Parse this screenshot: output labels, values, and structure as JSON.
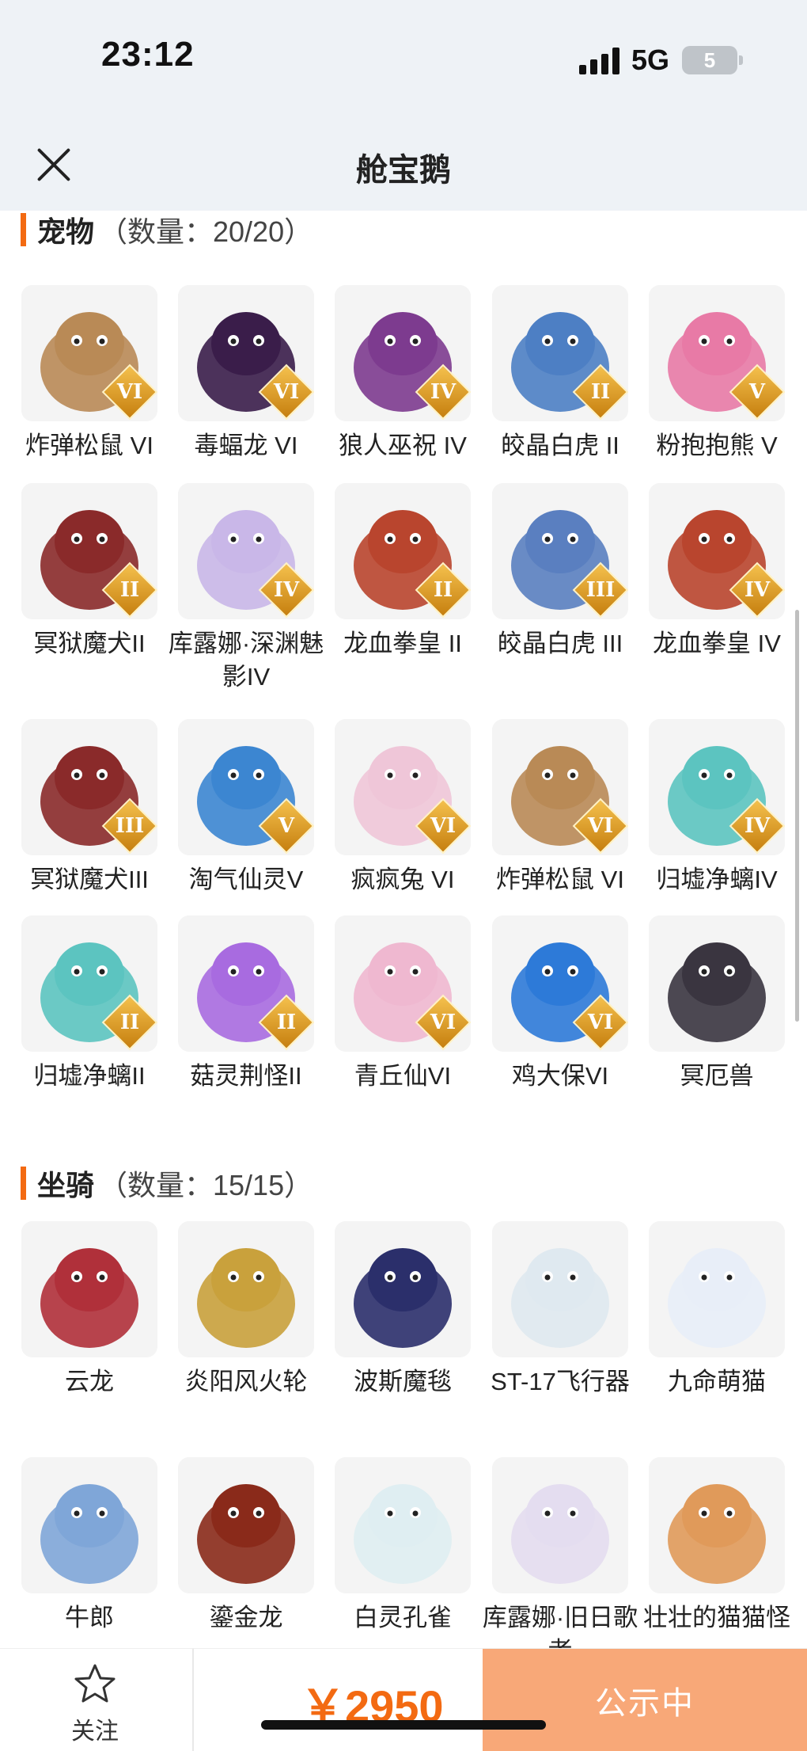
{
  "status_bar": {
    "time": "23:12",
    "network": "5G",
    "battery": "5"
  },
  "header": {
    "title": "舱宝鹅",
    "close_icon": "close-icon"
  },
  "pets_section": {
    "name": "宠物",
    "count_text": "（数量：20/20）",
    "items": [
      {
        "label": "炸弹松鼠 VI",
        "grade": "VI",
        "color": "#b98a56"
      },
      {
        "label": "毒蝠龙 VI",
        "grade": "VI",
        "color": "#3a1d4a"
      },
      {
        "label": "狼人巫祝 IV",
        "grade": "IV",
        "color": "#7d3b8f"
      },
      {
        "label": "皎晶白虎 II",
        "grade": "II",
        "color": "#4d7fc4"
      },
      {
        "label": "粉抱抱熊 V",
        "grade": "V",
        "color": "#e87aa6"
      },
      {
        "label": "冥狱魔犬II",
        "grade": "II",
        "color": "#8a2a2a"
      },
      {
        "label": "库露娜·深渊魅影IV",
        "grade": "IV",
        "color": "#c9b7e8"
      },
      {
        "label": "龙血拳皇 II",
        "grade": "II",
        "color": "#b9452e"
      },
      {
        "label": "皎晶白虎 III",
        "grade": "III",
        "color": "#5a7fc0"
      },
      {
        "label": "龙血拳皇 IV",
        "grade": "IV",
        "color": "#b9452e"
      },
      {
        "label": "冥狱魔犬III",
        "grade": "III",
        "color": "#8a2a2a"
      },
      {
        "label": "淘气仙灵V",
        "grade": "V",
        "color": "#3c86d1"
      },
      {
        "label": "疯疯兔 VI",
        "grade": "VI",
        "color": "#efc6d8"
      },
      {
        "label": "炸弹松鼠 VI",
        "grade": "VI",
        "color": "#b98a56"
      },
      {
        "label": "归墟净螭IV",
        "grade": "IV",
        "color": "#5cc4c0"
      },
      {
        "label": "归墟净螭II",
        "grade": "II",
        "color": "#5cc4c0"
      },
      {
        "label": "菇灵荆怪II",
        "grade": "II",
        "color": "#a86be0"
      },
      {
        "label": "青丘仙VI",
        "grade": "VI",
        "color": "#efb8d0"
      },
      {
        "label": "鸡大保VI",
        "grade": "VI",
        "color": "#2d7ad8"
      },
      {
        "label": "冥厄兽",
        "grade": "",
        "color": "#3a3540"
      }
    ]
  },
  "mounts_section": {
    "name": "坐骑",
    "count_text": "（数量：15/15）",
    "items": [
      {
        "label": "云龙",
        "color": "#b0303a"
      },
      {
        "label": "炎阳风火轮",
        "color": "#c9a13c"
      },
      {
        "label": "波斯魔毯",
        "color": "#2b2f6b"
      },
      {
        "label": "ST-17飞行器",
        "color": "#dfe9f0"
      },
      {
        "label": "九命萌猫",
        "color": "#e8eef8"
      },
      {
        "label": "牛郎",
        "color": "#7fa6d8"
      },
      {
        "label": "鎏金龙",
        "color": "#8a2a1a"
      },
      {
        "label": "白灵孔雀",
        "color": "#dfeef2"
      },
      {
        "label": "库露娜·旧日歌者",
        "color": "#e4ddf0"
      },
      {
        "label": "壮壮的猫猫怪",
        "color": "#e09a5a"
      }
    ]
  },
  "bottom_bar": {
    "follow_label": "关注",
    "price": "￥2950",
    "status_button": "公示中"
  }
}
